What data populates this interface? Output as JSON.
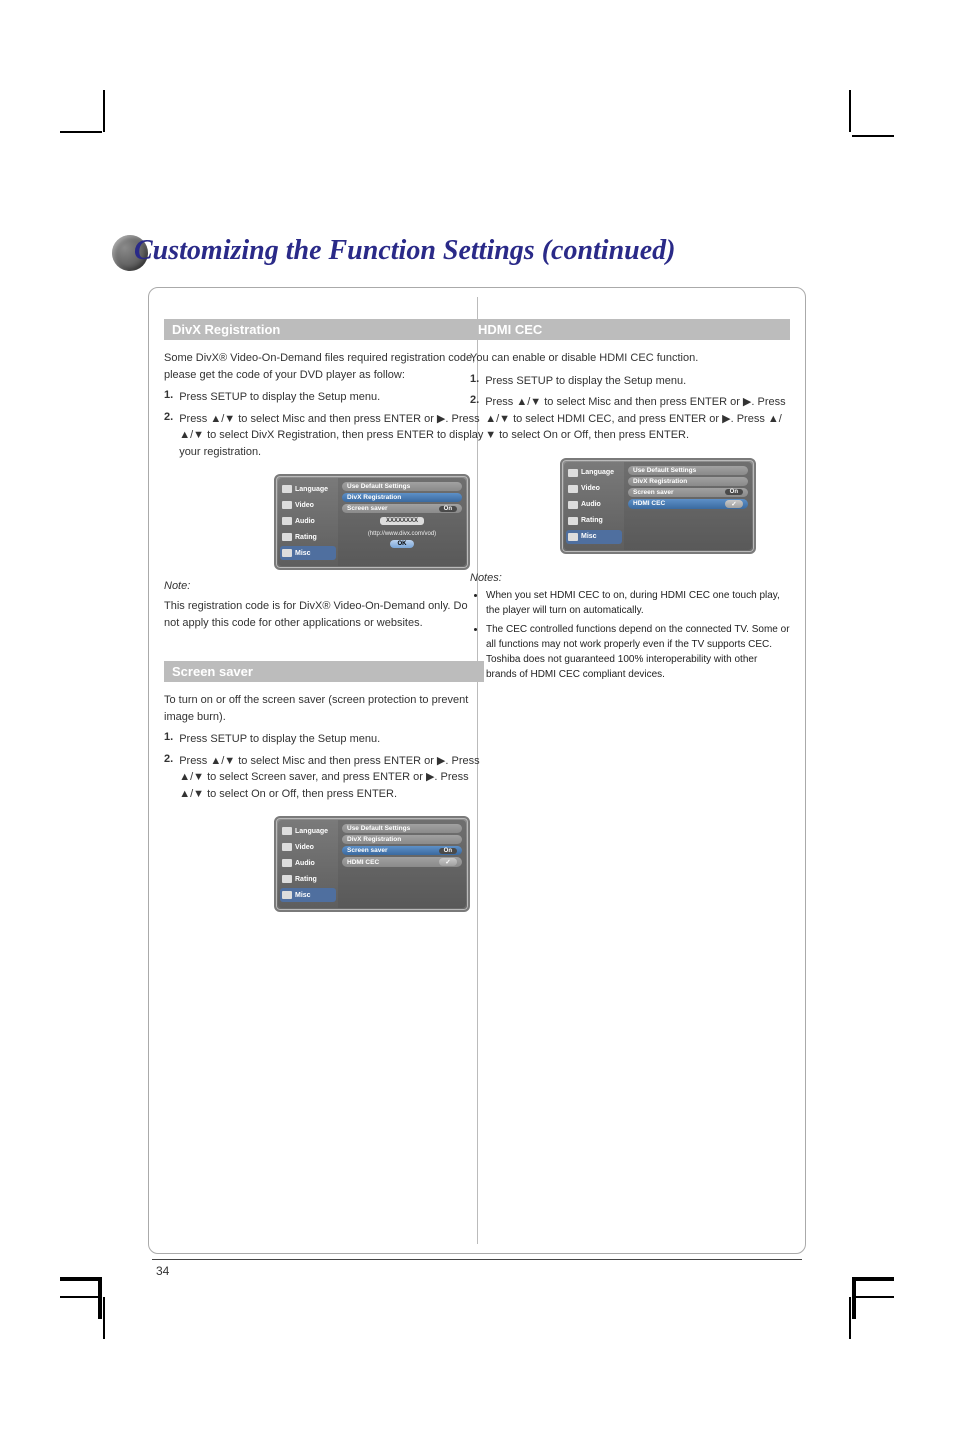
{
  "page_title": "Customizing the Function Settings (continued)",
  "page_number": "34",
  "sections": {
    "divx": {
      "heading": "DivX Registration",
      "intro": "Some DivX® Video-On-Demand files required registration code, please get the code of your DVD player as follow:",
      "steps": [
        {
          "n": "1.",
          "text": "Press SETUP to display the Setup menu."
        },
        {
          "n": "2.",
          "text": "Press ▲/▼ to select Misc and then press ENTER or ▶. Press ▲/▼ to select DivX Registration, then press ENTER to display your registration."
        }
      ],
      "note_label": "Note:",
      "note_text": "This registration code is for DivX® Video-On-Demand only. Do not apply this code for other applications or websites."
    },
    "screensaver": {
      "heading": "Screen saver",
      "intro": "To turn on or off the screen saver (screen protection to prevent image burn).",
      "steps": [
        {
          "n": "1.",
          "text": "Press SETUP to display the Setup menu."
        },
        {
          "n": "2.",
          "text": "Press ▲/▼ to select Misc and then press ENTER or ▶. Press ▲/▼ to select Screen saver, and press ENTER or ▶. Press ▲/▼ to select On or Off, then press ENTER."
        }
      ]
    },
    "hdmi": {
      "heading": "HDMI CEC",
      "intro": "You can enable or disable HDMI CEC function.",
      "steps": [
        {
          "n": "1.",
          "text": "Press SETUP to display the Setup menu."
        },
        {
          "n": "2.",
          "text": "Press ▲/▼ to select Misc and then press ENTER or ▶. Press ▲/▼ to select HDMI CEC, and press ENTER or ▶. Press ▲/▼ to select On or Off, then press ENTER."
        }
      ],
      "notes_label": "Notes:",
      "notes": [
        "When you set HDMI CEC to on, during HDMI CEC one touch play, the player will turn on automatically.",
        "The CEC controlled functions depend on the connected TV. Some or all functions may not work properly even if the TV supports CEC. Toshiba does not guaranteed 100% interoperability with other brands of HDMI CEC compliant devices."
      ]
    }
  },
  "osd": {
    "tabs": [
      "Language",
      "Video",
      "Audio",
      "Rating",
      "Misc"
    ],
    "selected_tab": "Misc",
    "rows": {
      "defaults": "Use Default Settings",
      "divx_reg": "DivX Registration",
      "screensaver_label": "Screen saver",
      "screensaver_value": "On",
      "hdmi_label": "HDMI CEC"
    },
    "divx_panel": {
      "url": "(http://www.divx.com/vod)",
      "ok": "OK",
      "reg_code": "XXXXXXXX"
    }
  }
}
